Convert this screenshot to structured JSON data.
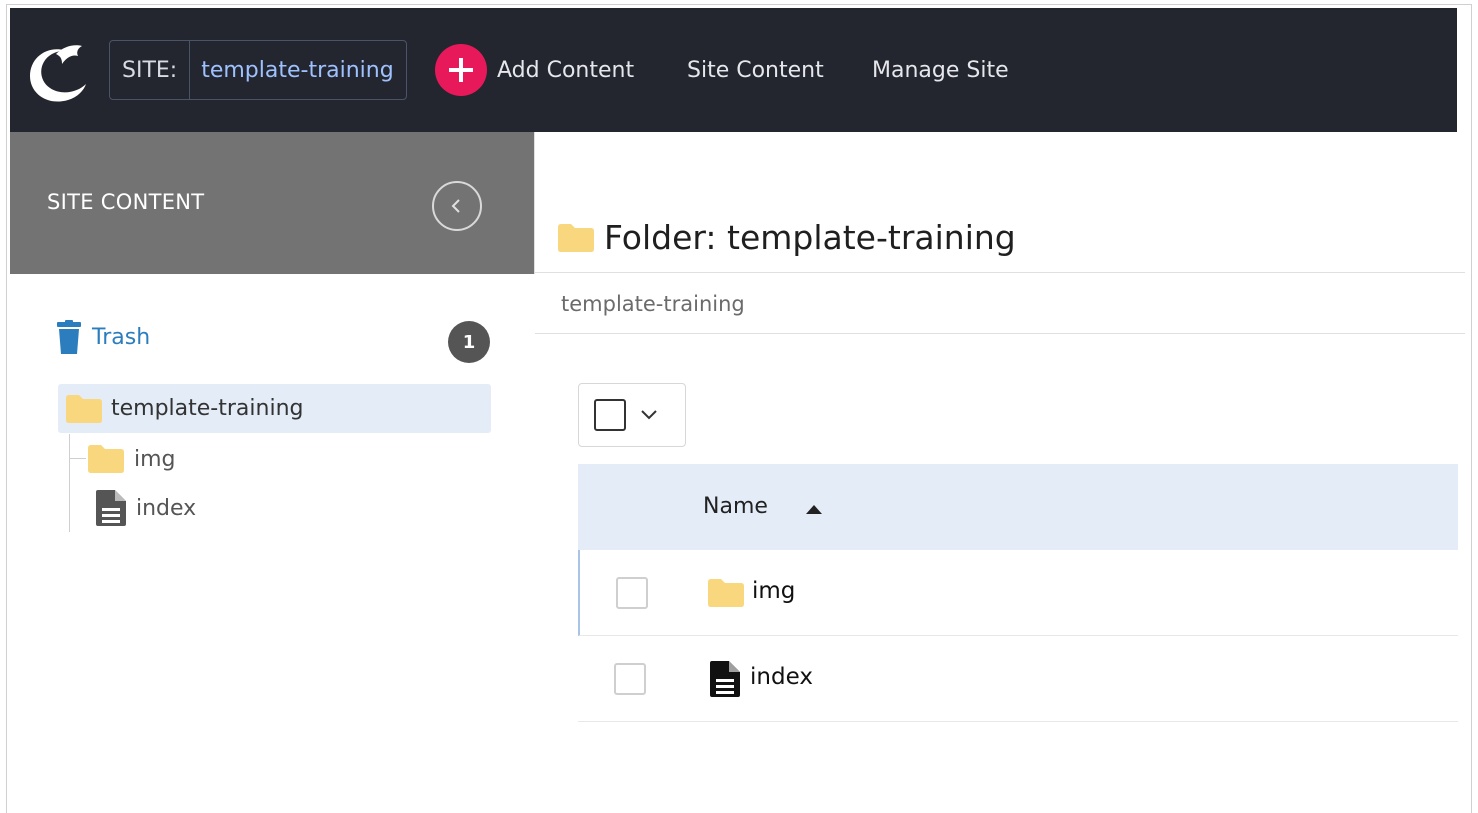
{
  "topbar": {
    "site_label": "SITE:",
    "site_name": "template-training",
    "add_content": "Add Content",
    "site_content": "Site Content",
    "manage_site": "Manage Site",
    "accent_color": "#e8195a"
  },
  "sidebar": {
    "title": "SITE CONTENT",
    "trash_label": "Trash",
    "trash_count": "1",
    "tree": {
      "root": "template-training",
      "children": [
        {
          "label": "img",
          "icon": "folder-icon"
        },
        {
          "label": "index",
          "icon": "document-icon"
        }
      ]
    }
  },
  "main": {
    "folder_title": "Folder: template-training",
    "breadcrumb": "template-training",
    "table": {
      "column_name": "Name",
      "sort": "ascending",
      "rows": [
        {
          "name": "img",
          "icon": "folder-icon"
        },
        {
          "name": "index",
          "icon": "document-icon"
        }
      ]
    }
  }
}
